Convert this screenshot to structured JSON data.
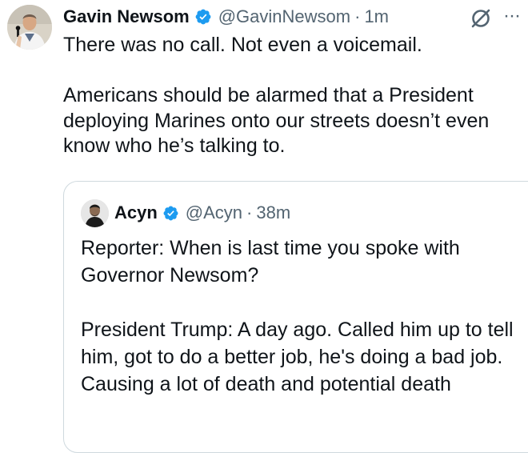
{
  "tweet": {
    "author_name": "Gavin Newsom",
    "handle": "@GavinNewsom",
    "separator": "·",
    "time": "1m",
    "verified_icon": "verified-badge-icon",
    "avatar_icon": "profile-photo",
    "paragraphs": [
      "There was no call. Not even a voicemail.",
      "Americans should be alarmed that a President deploying Marines onto our streets doesn’t even know who he’s talking to."
    ],
    "actions": {
      "grok_icon": "grok-icon",
      "more_icon": "more-options-icon"
    }
  },
  "quoted_tweet": {
    "author_name": "Acyn",
    "handle": "@Acyn",
    "separator": "·",
    "time": "38m",
    "verified_icon": "verified-badge-icon",
    "avatar_icon": "profile-photo",
    "paragraphs": [
      "Reporter: When is last time you spoke with Governor Newsom?",
      "President Trump: A day ago. Called him up to tell him, got to do a better job, he's doing a bad job. Causing a lot of death and potential death"
    ]
  },
  "colors": {
    "text": "#0f1419",
    "secondary": "#536471",
    "verified": "#1d9bf0",
    "border": "#cfd9de"
  }
}
